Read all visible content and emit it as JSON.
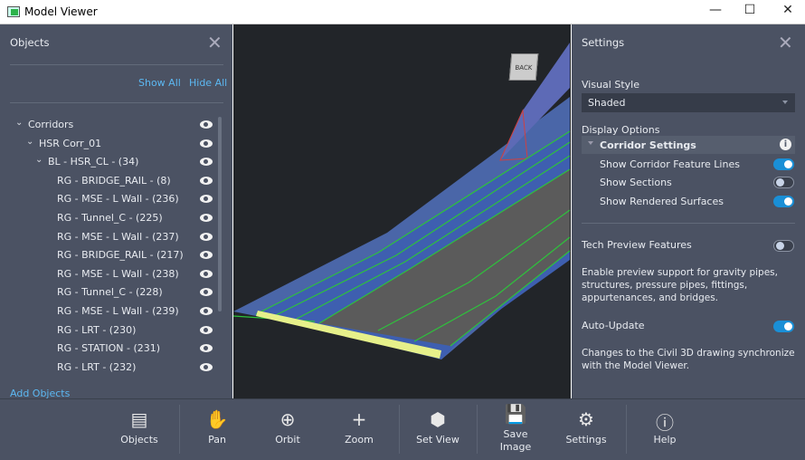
{
  "window": {
    "title": "Model Viewer",
    "minimize": "—",
    "maximize": "☐",
    "close": "✕"
  },
  "objects_panel": {
    "title": "Objects",
    "show_all": "Show All",
    "hide_all": "Hide All",
    "add_objects": "Add Objects",
    "tree": [
      {
        "label": "Corridors",
        "level": 0,
        "expanded": true
      },
      {
        "label": "HSR Corr_01",
        "level": 1,
        "expanded": true
      },
      {
        "label": "BL - HSR_CL - (34)",
        "level": 2,
        "expanded": true
      },
      {
        "label": "RG - BRIDGE_RAIL - (8)",
        "level": 3
      },
      {
        "label": "RG - MSE - L Wall - (236)",
        "level": 3
      },
      {
        "label": "RG - Tunnel_C - (225)",
        "level": 3
      },
      {
        "label": "RG - MSE - L Wall - (237)",
        "level": 3
      },
      {
        "label": "RG - BRIDGE_RAIL - (217)",
        "level": 3
      },
      {
        "label": "RG - MSE - L Wall - (238)",
        "level": 3
      },
      {
        "label": "RG - Tunnel_C - (228)",
        "level": 3
      },
      {
        "label": "RG - MSE - L Wall - (239)",
        "level": 3
      },
      {
        "label": "RG - LRT - (230)",
        "level": 3
      },
      {
        "label": "RG - STATION - (231)",
        "level": 3
      },
      {
        "label": "RG - LRT - (232)",
        "level": 3
      }
    ]
  },
  "viewcube": {
    "face": "BACK"
  },
  "settings_panel": {
    "title": "Settings",
    "visual_style_label": "Visual Style",
    "visual_style_value": "Shaded",
    "display_options": "Display Options",
    "corridor_settings": "Corridor Settings",
    "options": [
      {
        "label": "Show Corridor Feature Lines",
        "on": true
      },
      {
        "label": "Show Sections",
        "on": false
      },
      {
        "label": "Show Rendered Surfaces",
        "on": true
      }
    ],
    "tech_preview": {
      "label": "Tech Preview Features",
      "on": false,
      "desc": "Enable preview support for gravity pipes, structures, pressure pipes, fittings, appurtenances, and bridges."
    },
    "auto_update": {
      "label": "Auto-Update",
      "on": true,
      "desc": "Changes to the Civil 3D drawing synchronize with the Model Viewer."
    }
  },
  "toolbar": [
    {
      "label": "Objects",
      "icon": "objects-icon"
    },
    {
      "label": "Pan",
      "icon": "hand-icon"
    },
    {
      "label": "Orbit",
      "icon": "orbit-icon"
    },
    {
      "label": "Zoom",
      "icon": "zoom-icon"
    },
    {
      "label": "Set View",
      "icon": "set-view-icon"
    },
    {
      "label": "Save\nImage",
      "icon": "save-icon"
    },
    {
      "label": "Settings",
      "icon": "gear-icon"
    },
    {
      "label": "Help",
      "icon": "help-icon"
    }
  ],
  "colors": {
    "panel": "#4b5263",
    "accent": "#1a8fd6",
    "link": "#5cb8f2",
    "viewport": "#222529"
  }
}
